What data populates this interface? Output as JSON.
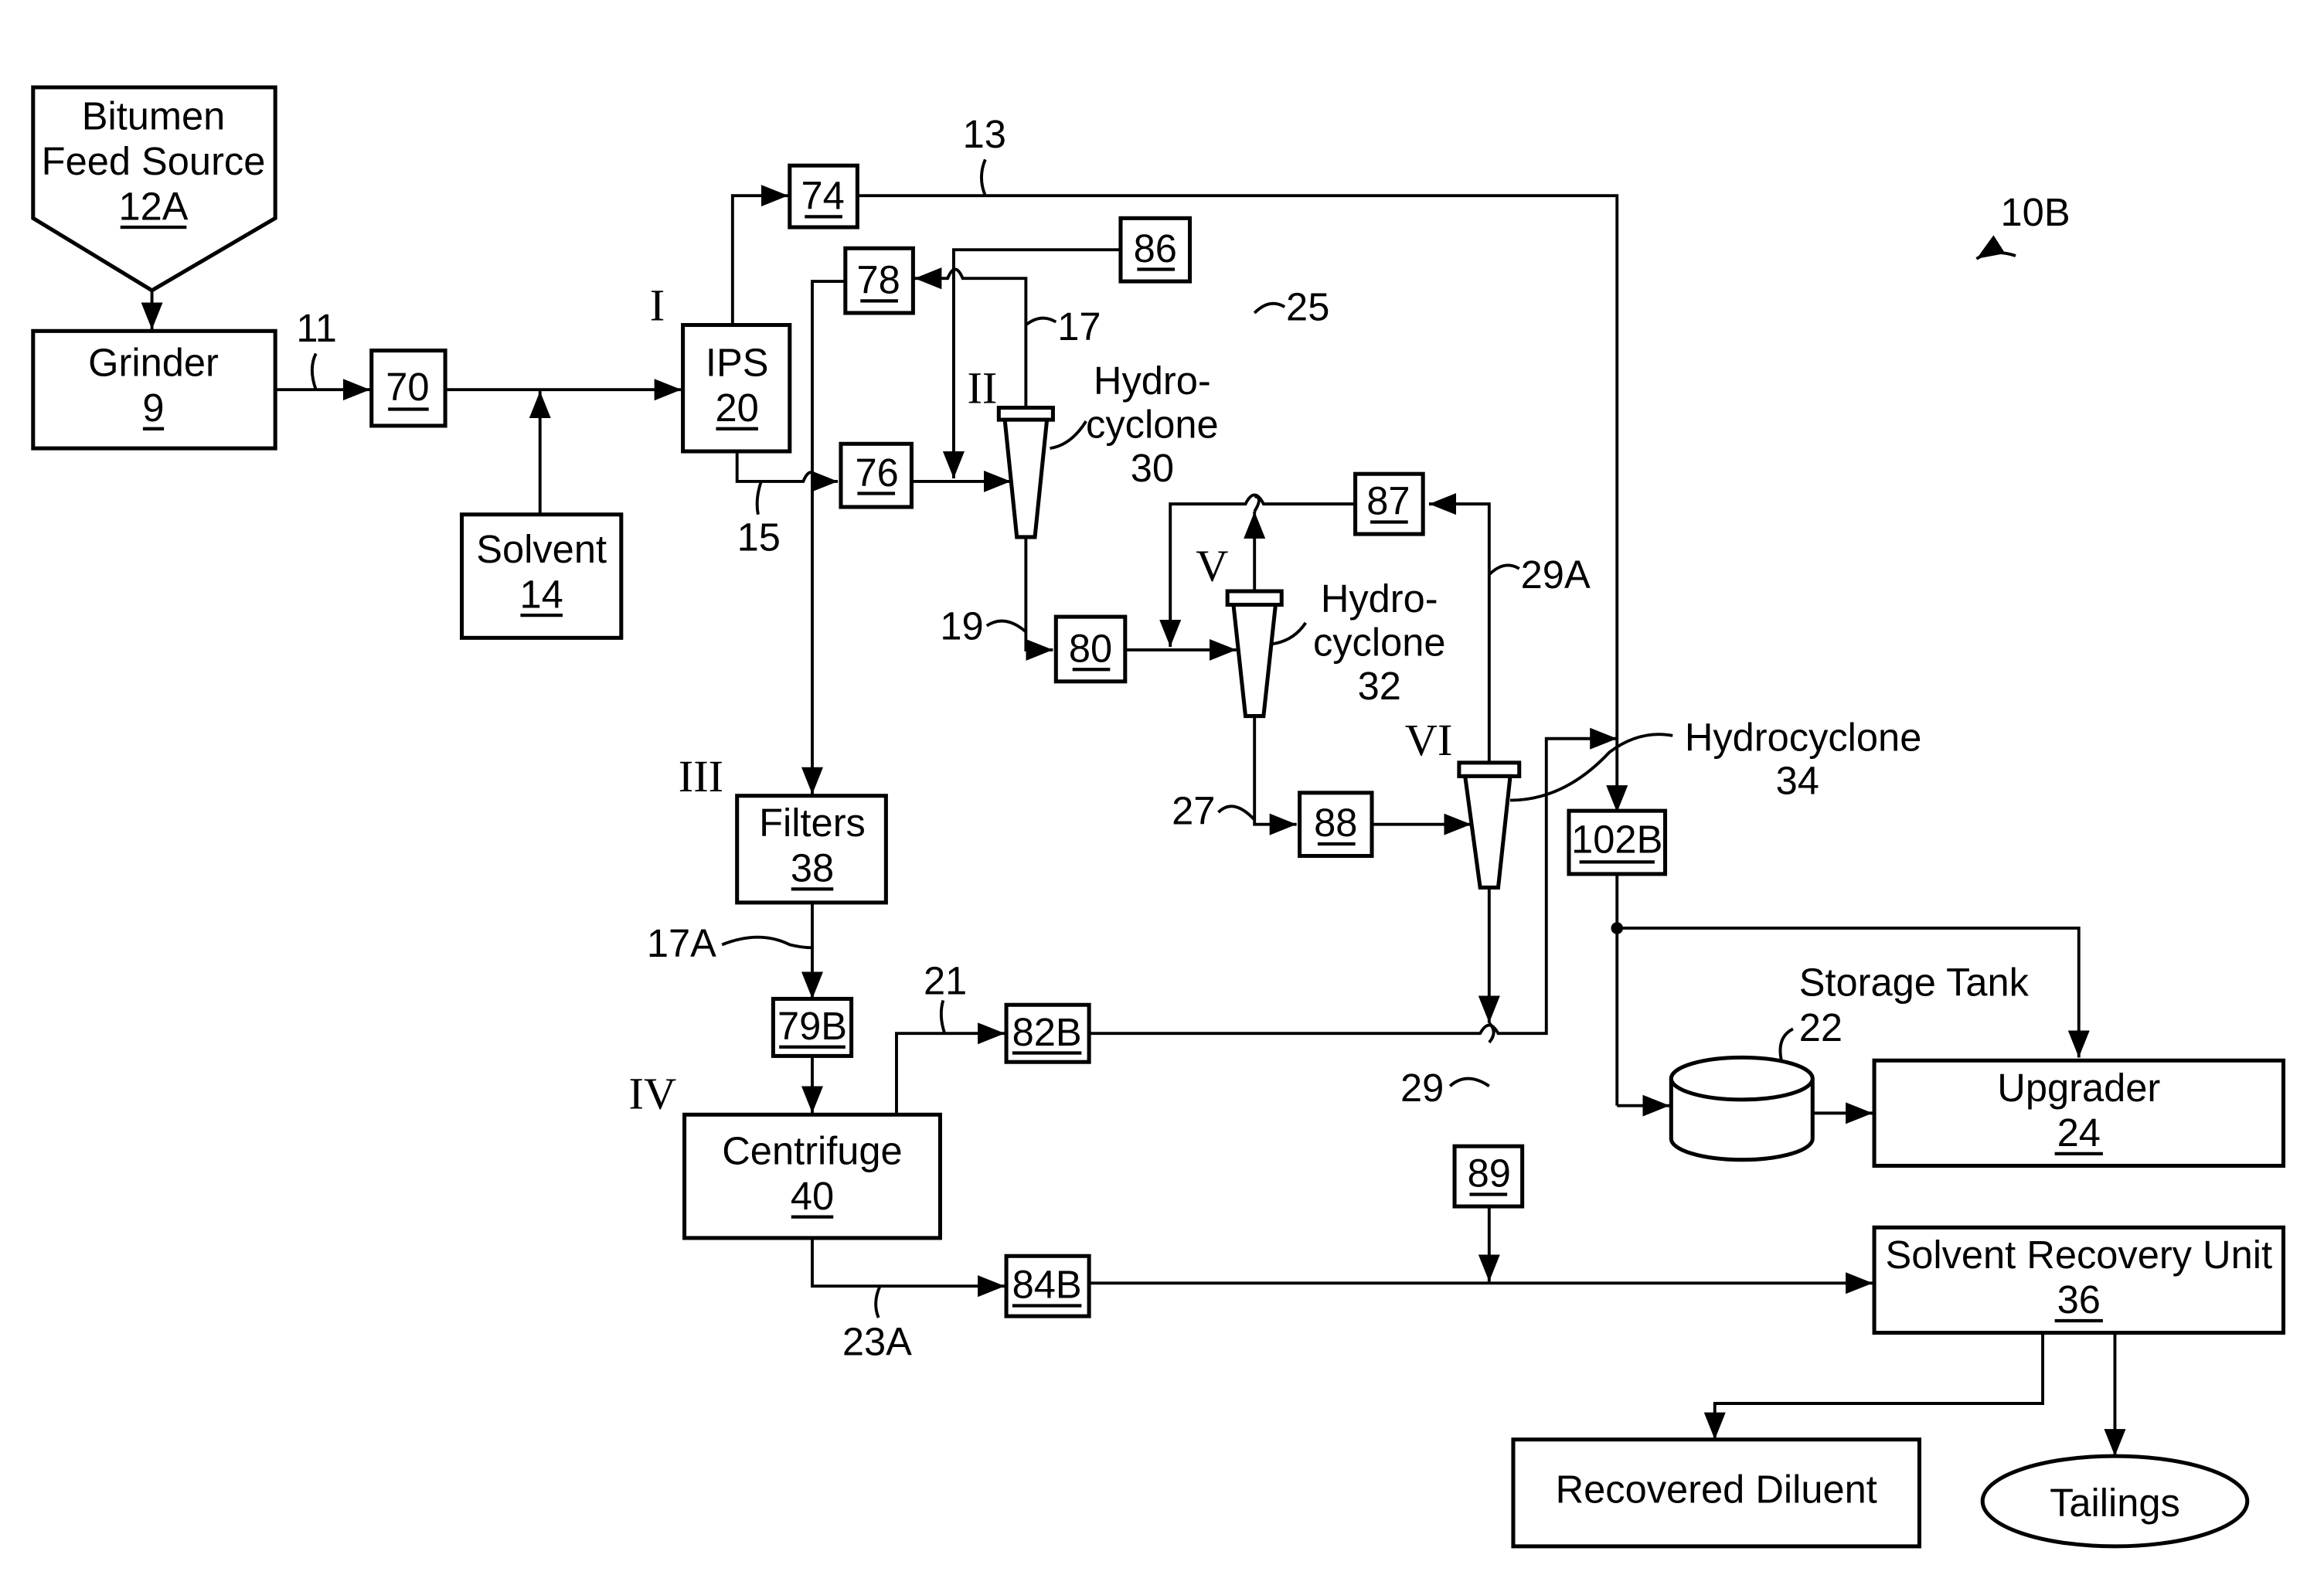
{
  "figure_label": "10B",
  "units": {
    "bitumen_feed": {
      "name": "Bitumen",
      "name2": "Feed Source",
      "ref": "12A"
    },
    "grinder": {
      "name": "Grinder",
      "ref": "9"
    },
    "solvent": {
      "name": "Solvent",
      "ref": "14"
    },
    "ips": {
      "name": "IPS",
      "ref": "20"
    },
    "hydrocyclone30": {
      "name1": "Hydro-",
      "name2": "cyclone",
      "ref": "30"
    },
    "hydrocyclone32": {
      "name1": "Hydro-",
      "name2": "cyclone",
      "ref": "32"
    },
    "hydrocyclone34": {
      "name": "Hydrocyclone",
      "ref": "34"
    },
    "filters": {
      "name": "Filters",
      "ref": "38"
    },
    "centrifuge": {
      "name": "Centrifuge",
      "ref": "40"
    },
    "storage_tank": {
      "name": "Storage Tank",
      "ref": "22"
    },
    "upgrader": {
      "name": "Upgrader",
      "ref": "24"
    },
    "solvent_recovery": {
      "name": "Solvent Recovery Unit",
      "ref": "36"
    },
    "recovered_diluent": {
      "name": "Recovered Diluent"
    },
    "tailings": {
      "name": "Tailings"
    }
  },
  "small_boxes": {
    "b70": "70",
    "b74": "74",
    "b76": "76",
    "b78": "78",
    "b80": "80",
    "b86": "86",
    "b87": "87",
    "b88": "88",
    "b89": "89",
    "b79b": "79B",
    "b82b": "82B",
    "b84b": "84B",
    "b102b": "102B"
  },
  "stream_labels": {
    "s11": "11",
    "s13": "13",
    "s15": "15",
    "s17": "17",
    "s17a": "17A",
    "s19": "19",
    "s21": "21",
    "s23a": "23A",
    "s25": "25",
    "s27": "27",
    "s29": "29",
    "s29a": "29A"
  },
  "stage_labels": {
    "I": "I",
    "II": "II",
    "III": "III",
    "IV": "IV",
    "V": "V",
    "VI": "VI"
  }
}
